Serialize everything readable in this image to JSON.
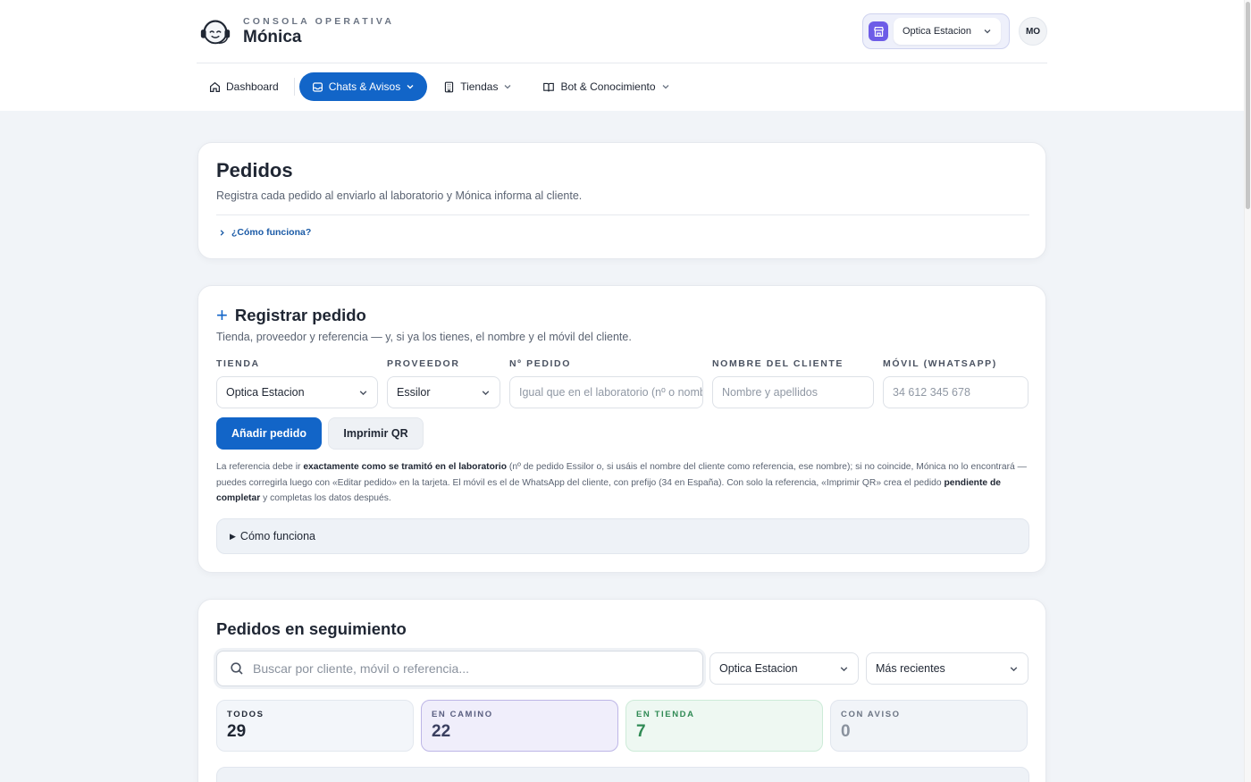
{
  "brand": {
    "kicker": "CONSOLA OPERATIVA",
    "name": "Mónica"
  },
  "header": {
    "store_selected": "Optica Estacion",
    "avatar_initials": "MO"
  },
  "nav": {
    "items": [
      {
        "label": "Dashboard",
        "icon": "home-icon"
      },
      {
        "label": "Chats & Avisos",
        "icon": "inbox-icon",
        "active": true
      },
      {
        "label": "Tiendas",
        "icon": "building-icon"
      },
      {
        "label": "Bot & Conocimiento",
        "icon": "book-icon"
      }
    ]
  },
  "intro": {
    "title": "Pedidos",
    "subtitle": "Registra cada pedido al enviarlo al laboratorio y Mónica informa al cliente.",
    "how_link": "¿Cómo funciona?"
  },
  "register": {
    "title": "Registrar pedido",
    "subtitle": "Tienda, proveedor y referencia — y, si ya los tienes, el nombre y el móvil del cliente.",
    "fields": {
      "store": {
        "label": "TIENDA",
        "value": "Optica Estacion"
      },
      "supplier": {
        "label": "PROVEEDOR",
        "value": "Essilor"
      },
      "order_no": {
        "label": "Nº PEDIDO",
        "placeholder": "Igual que en el laboratorio (nº o nombre)"
      },
      "customer": {
        "label": "NOMBRE DEL CLIENTE",
        "placeholder": "Nombre y apellidos"
      },
      "mobile": {
        "label": "MÓVIL (WHATSAPP)",
        "placeholder": "34 612 345 678"
      }
    },
    "add_button": "Añadir pedido",
    "print_button": "Imprimir QR",
    "note": {
      "p1": "La referencia debe ir ",
      "b1": "exactamente como se tramitó en el laboratorio",
      "p2": " (nº de pedido Essilor o, si usáis el nombre del cliente como referencia, ese nombre); si no coincide, Mónica no lo encontrará —puedes corregirla luego con «Editar pedido» en la tarjeta. El móvil es el de WhatsApp del cliente, con prefijo (34 en España). Con solo la referencia, «Imprimir QR» crea el pedido ",
      "b2": "pendiente de completar",
      "p3": " y completas los datos después."
    },
    "details_label": "Cómo funciona"
  },
  "tracking": {
    "title": "Pedidos en seguimiento",
    "search_placeholder": "Buscar por cliente, móvil o referencia...",
    "store_filter": "Optica Estacion",
    "sort": "Más recientes",
    "stats": [
      {
        "label": "TODOS",
        "value": "29"
      },
      {
        "label": "EN CAMINO",
        "value": "22"
      },
      {
        "label": "EN TIENDA",
        "value": "7"
      },
      {
        "label": "CON AVISO",
        "value": "0"
      }
    ]
  },
  "colors": {
    "primary": "#1265c8",
    "store_accent": "#6d5ce7",
    "success": "#2f8a54"
  }
}
